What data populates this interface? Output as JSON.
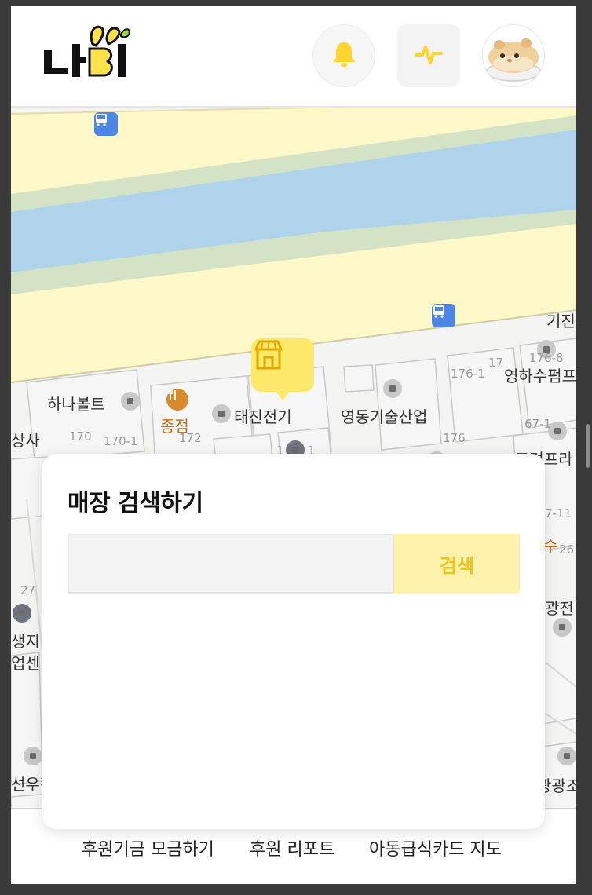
{
  "app": {
    "logo_text": "나비",
    "accent_color": "#ffe96a",
    "accent_text_color": "#f0c419"
  },
  "header": {
    "bell_icon": "bell-icon",
    "activity_icon": "activity-pulse-icon",
    "avatar_icon": "hamster-avatar"
  },
  "map": {
    "labels": {
      "hanabolt": "하나볼트",
      "jongjeom": "종점",
      "taejin": "태진전기",
      "yeongdong": "영동기술산업",
      "sangsa": "상사",
      "gijin": "기진",
      "younghasupump": "영하수펌프",
      "goryeo": "고려프라",
      "saengji": "생지",
      "eopsen": "업센",
      "gwangjin": "광전",
      "gwanggwang": "광광조",
      "seonwoo": "선우정",
      "su": "수"
    },
    "numbers": {
      "n170": "170",
      "n170_1": "170-1",
      "n172": "172",
      "n176": "176",
      "n176_1": "176-1",
      "n176_8": "176-8",
      "n17": "17",
      "n67_1": "67-1",
      "n7_11": "7-11",
      "n26": "26",
      "n27": "27",
      "n1_1": "1",
      "n1_2": "1"
    }
  },
  "search_panel": {
    "title": "매장 검색하기",
    "input_value": "",
    "input_placeholder": "",
    "button_label": "검색"
  },
  "footer": {
    "links": [
      {
        "label": "후원기금 모금하기"
      },
      {
        "label": "후원 리포트"
      },
      {
        "label": "아동급식카드 지도"
      }
    ]
  }
}
